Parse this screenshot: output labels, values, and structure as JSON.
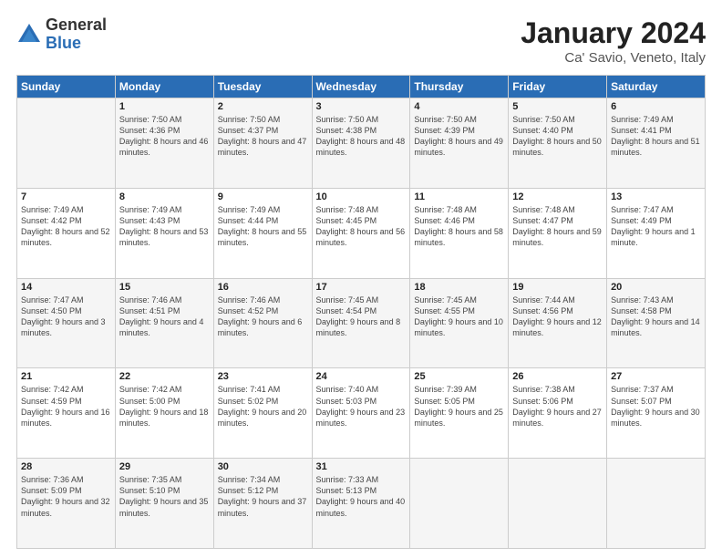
{
  "header": {
    "logo": {
      "general": "General",
      "blue": "Blue"
    },
    "title": "January 2024",
    "subtitle": "Ca' Savio, Veneto, Italy"
  },
  "calendar": {
    "days_of_week": [
      "Sunday",
      "Monday",
      "Tuesday",
      "Wednesday",
      "Thursday",
      "Friday",
      "Saturday"
    ],
    "weeks": [
      [
        {
          "day": "",
          "sunrise": "",
          "sunset": "",
          "daylight": ""
        },
        {
          "day": "1",
          "sunrise": "Sunrise: 7:50 AM",
          "sunset": "Sunset: 4:36 PM",
          "daylight": "Daylight: 8 hours and 46 minutes."
        },
        {
          "day": "2",
          "sunrise": "Sunrise: 7:50 AM",
          "sunset": "Sunset: 4:37 PM",
          "daylight": "Daylight: 8 hours and 47 minutes."
        },
        {
          "day": "3",
          "sunrise": "Sunrise: 7:50 AM",
          "sunset": "Sunset: 4:38 PM",
          "daylight": "Daylight: 8 hours and 48 minutes."
        },
        {
          "day": "4",
          "sunrise": "Sunrise: 7:50 AM",
          "sunset": "Sunset: 4:39 PM",
          "daylight": "Daylight: 8 hours and 49 minutes."
        },
        {
          "day": "5",
          "sunrise": "Sunrise: 7:50 AM",
          "sunset": "Sunset: 4:40 PM",
          "daylight": "Daylight: 8 hours and 50 minutes."
        },
        {
          "day": "6",
          "sunrise": "Sunrise: 7:49 AM",
          "sunset": "Sunset: 4:41 PM",
          "daylight": "Daylight: 8 hours and 51 minutes."
        }
      ],
      [
        {
          "day": "7",
          "sunrise": "Sunrise: 7:49 AM",
          "sunset": "Sunset: 4:42 PM",
          "daylight": "Daylight: 8 hours and 52 minutes."
        },
        {
          "day": "8",
          "sunrise": "Sunrise: 7:49 AM",
          "sunset": "Sunset: 4:43 PM",
          "daylight": "Daylight: 8 hours and 53 minutes."
        },
        {
          "day": "9",
          "sunrise": "Sunrise: 7:49 AM",
          "sunset": "Sunset: 4:44 PM",
          "daylight": "Daylight: 8 hours and 55 minutes."
        },
        {
          "day": "10",
          "sunrise": "Sunrise: 7:48 AM",
          "sunset": "Sunset: 4:45 PM",
          "daylight": "Daylight: 8 hours and 56 minutes."
        },
        {
          "day": "11",
          "sunrise": "Sunrise: 7:48 AM",
          "sunset": "Sunset: 4:46 PM",
          "daylight": "Daylight: 8 hours and 58 minutes."
        },
        {
          "day": "12",
          "sunrise": "Sunrise: 7:48 AM",
          "sunset": "Sunset: 4:47 PM",
          "daylight": "Daylight: 8 hours and 59 minutes."
        },
        {
          "day": "13",
          "sunrise": "Sunrise: 7:47 AM",
          "sunset": "Sunset: 4:49 PM",
          "daylight": "Daylight: 9 hours and 1 minute."
        }
      ],
      [
        {
          "day": "14",
          "sunrise": "Sunrise: 7:47 AM",
          "sunset": "Sunset: 4:50 PM",
          "daylight": "Daylight: 9 hours and 3 minutes."
        },
        {
          "day": "15",
          "sunrise": "Sunrise: 7:46 AM",
          "sunset": "Sunset: 4:51 PM",
          "daylight": "Daylight: 9 hours and 4 minutes."
        },
        {
          "day": "16",
          "sunrise": "Sunrise: 7:46 AM",
          "sunset": "Sunset: 4:52 PM",
          "daylight": "Daylight: 9 hours and 6 minutes."
        },
        {
          "day": "17",
          "sunrise": "Sunrise: 7:45 AM",
          "sunset": "Sunset: 4:54 PM",
          "daylight": "Daylight: 9 hours and 8 minutes."
        },
        {
          "day": "18",
          "sunrise": "Sunrise: 7:45 AM",
          "sunset": "Sunset: 4:55 PM",
          "daylight": "Daylight: 9 hours and 10 minutes."
        },
        {
          "day": "19",
          "sunrise": "Sunrise: 7:44 AM",
          "sunset": "Sunset: 4:56 PM",
          "daylight": "Daylight: 9 hours and 12 minutes."
        },
        {
          "day": "20",
          "sunrise": "Sunrise: 7:43 AM",
          "sunset": "Sunset: 4:58 PM",
          "daylight": "Daylight: 9 hours and 14 minutes."
        }
      ],
      [
        {
          "day": "21",
          "sunrise": "Sunrise: 7:42 AM",
          "sunset": "Sunset: 4:59 PM",
          "daylight": "Daylight: 9 hours and 16 minutes."
        },
        {
          "day": "22",
          "sunrise": "Sunrise: 7:42 AM",
          "sunset": "Sunset: 5:00 PM",
          "daylight": "Daylight: 9 hours and 18 minutes."
        },
        {
          "day": "23",
          "sunrise": "Sunrise: 7:41 AM",
          "sunset": "Sunset: 5:02 PM",
          "daylight": "Daylight: 9 hours and 20 minutes."
        },
        {
          "day": "24",
          "sunrise": "Sunrise: 7:40 AM",
          "sunset": "Sunset: 5:03 PM",
          "daylight": "Daylight: 9 hours and 23 minutes."
        },
        {
          "day": "25",
          "sunrise": "Sunrise: 7:39 AM",
          "sunset": "Sunset: 5:05 PM",
          "daylight": "Daylight: 9 hours and 25 minutes."
        },
        {
          "day": "26",
          "sunrise": "Sunrise: 7:38 AM",
          "sunset": "Sunset: 5:06 PM",
          "daylight": "Daylight: 9 hours and 27 minutes."
        },
        {
          "day": "27",
          "sunrise": "Sunrise: 7:37 AM",
          "sunset": "Sunset: 5:07 PM",
          "daylight": "Daylight: 9 hours and 30 minutes."
        }
      ],
      [
        {
          "day": "28",
          "sunrise": "Sunrise: 7:36 AM",
          "sunset": "Sunset: 5:09 PM",
          "daylight": "Daylight: 9 hours and 32 minutes."
        },
        {
          "day": "29",
          "sunrise": "Sunrise: 7:35 AM",
          "sunset": "Sunset: 5:10 PM",
          "daylight": "Daylight: 9 hours and 35 minutes."
        },
        {
          "day": "30",
          "sunrise": "Sunrise: 7:34 AM",
          "sunset": "Sunset: 5:12 PM",
          "daylight": "Daylight: 9 hours and 37 minutes."
        },
        {
          "day": "31",
          "sunrise": "Sunrise: 7:33 AM",
          "sunset": "Sunset: 5:13 PM",
          "daylight": "Daylight: 9 hours and 40 minutes."
        },
        {
          "day": "",
          "sunrise": "",
          "sunset": "",
          "daylight": ""
        },
        {
          "day": "",
          "sunrise": "",
          "sunset": "",
          "daylight": ""
        },
        {
          "day": "",
          "sunrise": "",
          "sunset": "",
          "daylight": ""
        }
      ]
    ]
  }
}
